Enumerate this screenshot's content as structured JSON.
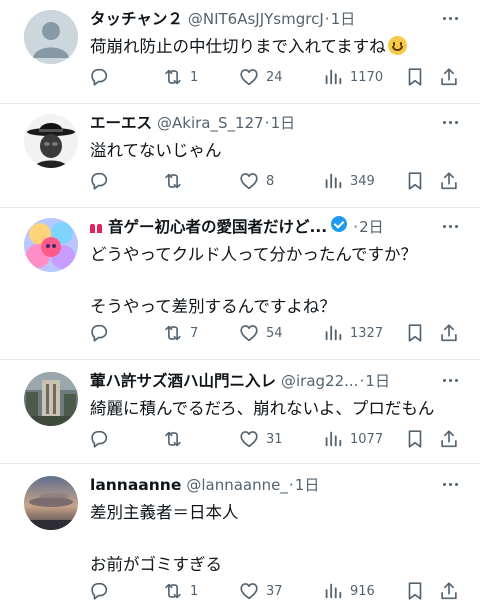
{
  "tweets": [
    {
      "name": "タッチャン２",
      "handle": "@NIT6AsJJYsmgrcJ",
      "time": "1日",
      "text": "荷崩れ防止の中仕切りまで入れてますね",
      "emoji": "grinning-face-emoji",
      "avatar": "default-avatar",
      "reply_count": "",
      "retweet_count": "1",
      "like_count": "24",
      "view_count": "1170"
    },
    {
      "name": "エーエス",
      "handle": "@Akira_S_127",
      "time": "1日",
      "text": "溢れてないじゃん",
      "avatar": "hat-figure-avatar",
      "reply_count": "",
      "retweet_count": "",
      "like_count": "8",
      "view_count": "349"
    },
    {
      "name": "音ゲー初心者の愛国者だけど...",
      "handle": "",
      "time": "2日",
      "text": "どうやってクルド人って分かったんですか？\n\nそうやって差別するんですよね？",
      "avatar": "anime-girls-avatar",
      "verified": true,
      "reply_count": "",
      "retweet_count": "7",
      "like_count": "54",
      "view_count": "1327"
    },
    {
      "name": "葷ハ許サズ酒ハ山門ニ入レ",
      "handle": "@irag22...",
      "time": "1日",
      "text": "綺麗に積んでるだろ、崩れないよ、プロだもん",
      "avatar": "stone-monument-avatar",
      "reply_count": "",
      "retweet_count": "",
      "like_count": "31",
      "view_count": "1077"
    },
    {
      "name": "lannaanne",
      "handle": "@lannaanne_",
      "time": "1日",
      "text": "差別主義者＝日本人\n\nお前がゴミすぎる",
      "avatar": "sunset-clouds-avatar",
      "reply_count": "",
      "retweet_count": "1",
      "like_count": "37",
      "view_count": "916"
    }
  ],
  "colors": {
    "text": "#0f1419",
    "muted": "#536471",
    "verified": "#1d9bf0",
    "divider": "#e6e9ec"
  },
  "icons": [
    "reply-icon",
    "retweet-icon",
    "like-icon",
    "views-icon",
    "bookmark-icon",
    "share-icon",
    "more-icon"
  ]
}
